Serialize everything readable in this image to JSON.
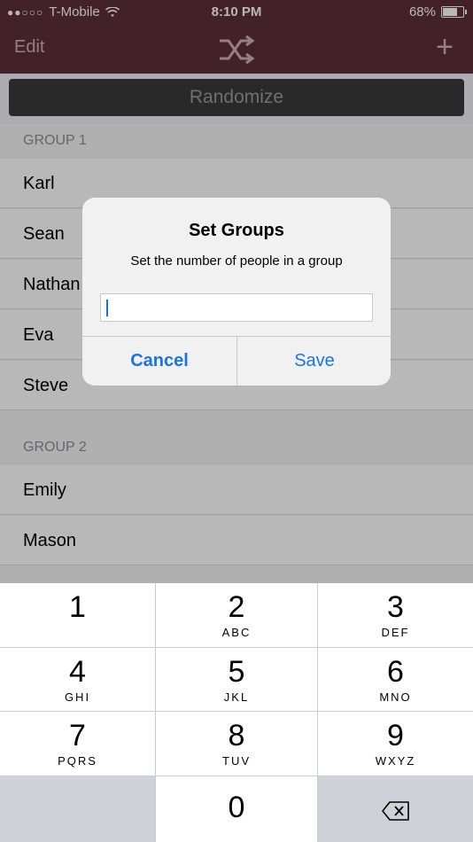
{
  "status": {
    "signal": "●●○○○",
    "carrier": "T-Mobile",
    "time": "8:10 PM",
    "battery": "68%",
    "battery_level": 0.68
  },
  "nav": {
    "edit_label": "Edit",
    "add_label": "+",
    "shuffle_icon": "shuffle-icon",
    "color": "#5c2e3b"
  },
  "randomize_label": "Randomize",
  "groups": [
    {
      "title": "GROUP 1",
      "members": [
        "Karl",
        "Sean",
        "Nathan",
        "Eva",
        "Steve"
      ]
    },
    {
      "title": "GROUP 2",
      "members": [
        "Emily",
        "Mason"
      ]
    }
  ],
  "alert": {
    "title": "Set Groups",
    "message": "Set the number of people in a group",
    "input_value": "",
    "cancel_label": "Cancel",
    "save_label": "Save"
  },
  "keypad": {
    "keys": [
      {
        "num": "1",
        "letters": ""
      },
      {
        "num": "2",
        "letters": "ABC"
      },
      {
        "num": "3",
        "letters": "DEF"
      },
      {
        "num": "4",
        "letters": "GHI"
      },
      {
        "num": "5",
        "letters": "JKL"
      },
      {
        "num": "6",
        "letters": "MNO"
      },
      {
        "num": "7",
        "letters": "PQRS"
      },
      {
        "num": "8",
        "letters": "TUV"
      },
      {
        "num": "9",
        "letters": "WXYZ"
      },
      {
        "num": "0",
        "letters": ""
      }
    ],
    "backspace_icon": "backspace-icon"
  }
}
